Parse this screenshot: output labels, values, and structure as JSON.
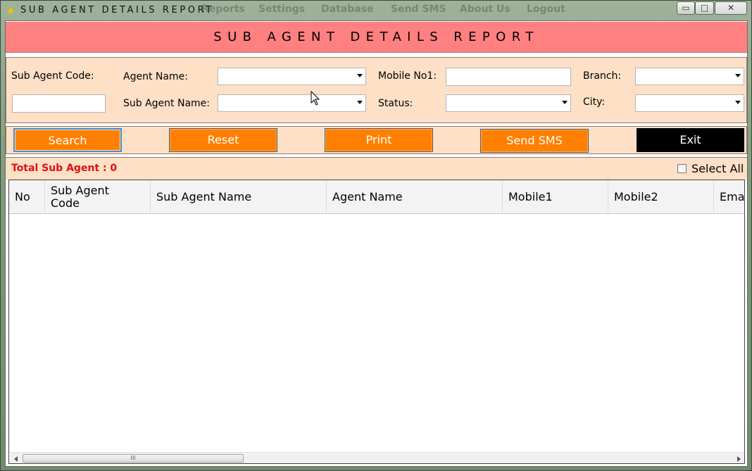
{
  "window": {
    "title": "SUB AGENT DETAILS REPORT",
    "ghost_menu": [
      "Reports",
      "Settings",
      "Database",
      "Send SMS",
      "About Us",
      "Logout"
    ],
    "controls": {
      "minimize": "▭",
      "maximize": "□",
      "close": "✕"
    }
  },
  "header": {
    "title": "SUB AGENT DETAILS REPORT"
  },
  "filters": {
    "sub_agent_code_label": "Sub Agent Code:",
    "sub_agent_code_value": "",
    "agent_name_label": "Agent Name:",
    "agent_name_value": "",
    "sub_agent_name_label": "Sub Agent Name:",
    "sub_agent_name_value": "",
    "mobile_label": "Mobile No1:",
    "mobile_value": "",
    "status_label": "Status:",
    "status_value": "",
    "branch_label": "Branch:",
    "branch_value": "",
    "city_label": "City:",
    "city_value": ""
  },
  "actions": {
    "search": "Search",
    "reset": "Reset",
    "print": "Print",
    "send_sms": "Send SMS",
    "exit": "Exit"
  },
  "summary": {
    "total_label": "Total Sub Agent : 0",
    "select_all_label": "Select All",
    "select_all_checked": false
  },
  "grid": {
    "columns": [
      "No",
      "Sub Agent Code",
      "Sub Agent Name",
      "Agent Name",
      "Mobile1",
      "Mobile2",
      "Email"
    ],
    "rows": [],
    "scroll_thumb": "III"
  },
  "colors": {
    "header_bg": "#ff8080",
    "panel_bg": "#fde0c6",
    "button_bg": "#ff8000",
    "exit_bg": "#000000",
    "total_text": "#e01010"
  }
}
